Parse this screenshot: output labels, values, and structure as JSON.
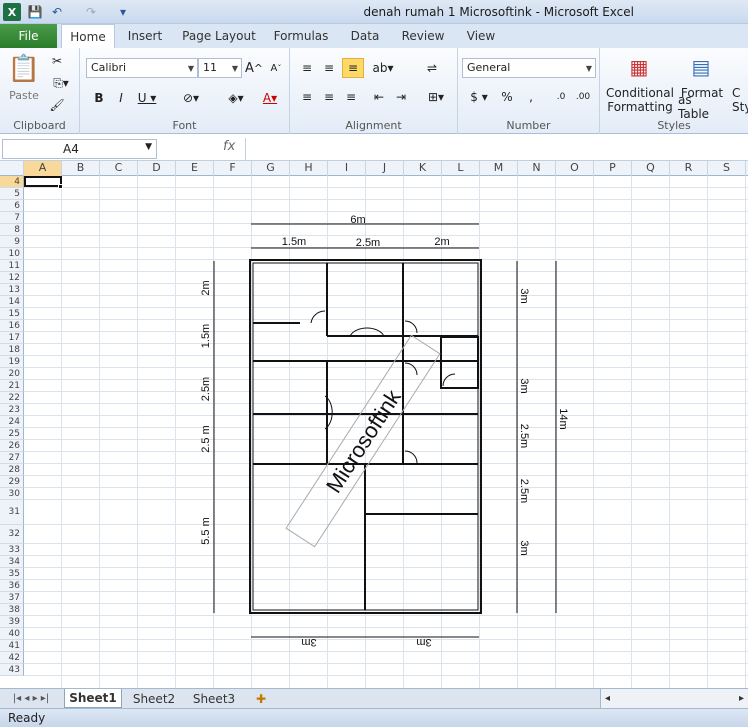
{
  "window": {
    "title": "denah rumah 1 Microsoftink  -  Microsoft Excel",
    "app_icon": "X"
  },
  "qat": {
    "save": "💾",
    "undo": "↶",
    "redo": "↷",
    "customize": "▾"
  },
  "tabs": {
    "file": "File",
    "items": [
      "Home",
      "Insert",
      "Page Layout",
      "Formulas",
      "Data",
      "Review",
      "View"
    ]
  },
  "ribbon": {
    "clipboard": {
      "label": "Clipboard",
      "paste": "Paste"
    },
    "font": {
      "label": "Font",
      "name": "Calibri",
      "size": "11"
    },
    "alignment": {
      "label": "Alignment"
    },
    "number": {
      "label": "Number",
      "format": "General"
    },
    "styles": {
      "label": "Styles",
      "conditional": "Conditional",
      "conditional2": "Formatting",
      "format_as": "Format",
      "format_as2": "as Table",
      "cell_styles": "C",
      "cell_styles2": "Sty"
    }
  },
  "formula": {
    "namebox": "A4",
    "fx": "fx",
    "value": ""
  },
  "columns": [
    "A",
    "B",
    "C",
    "D",
    "E",
    "F",
    "G",
    "H",
    "I",
    "J",
    "K",
    "L",
    "M",
    "N",
    "O",
    "P",
    "Q",
    "R",
    "S"
  ],
  "rows": [
    "4",
    "5",
    "6",
    "7",
    "8",
    "9",
    "10",
    "11",
    "12",
    "13",
    "14",
    "15",
    "16",
    "17",
    "18",
    "19",
    "20",
    "21",
    "22",
    "23",
    "24",
    "25",
    "26",
    "27",
    "28",
    "29",
    "30",
    "31",
    "32",
    "33",
    "34",
    "35",
    "36",
    "37",
    "38",
    "39",
    "40",
    "41",
    "42",
    "43"
  ],
  "plan": {
    "top_total": "6m",
    "top_a": "1.5m",
    "top_b": "2.5m",
    "top_c": "2m",
    "left": [
      "2m",
      "1.5m",
      "2.5m",
      "2.5 m",
      "5.5 m"
    ],
    "right": [
      "3m",
      "3m",
      "2.5m",
      "2.5m",
      "3m"
    ],
    "total_right": "14m",
    "bottom_left": "3m",
    "bottom_right": "3m",
    "watermark": "Microsoftink"
  },
  "sheets": [
    "Sheet1",
    "Sheet2",
    "Sheet3"
  ],
  "status": "Ready"
}
